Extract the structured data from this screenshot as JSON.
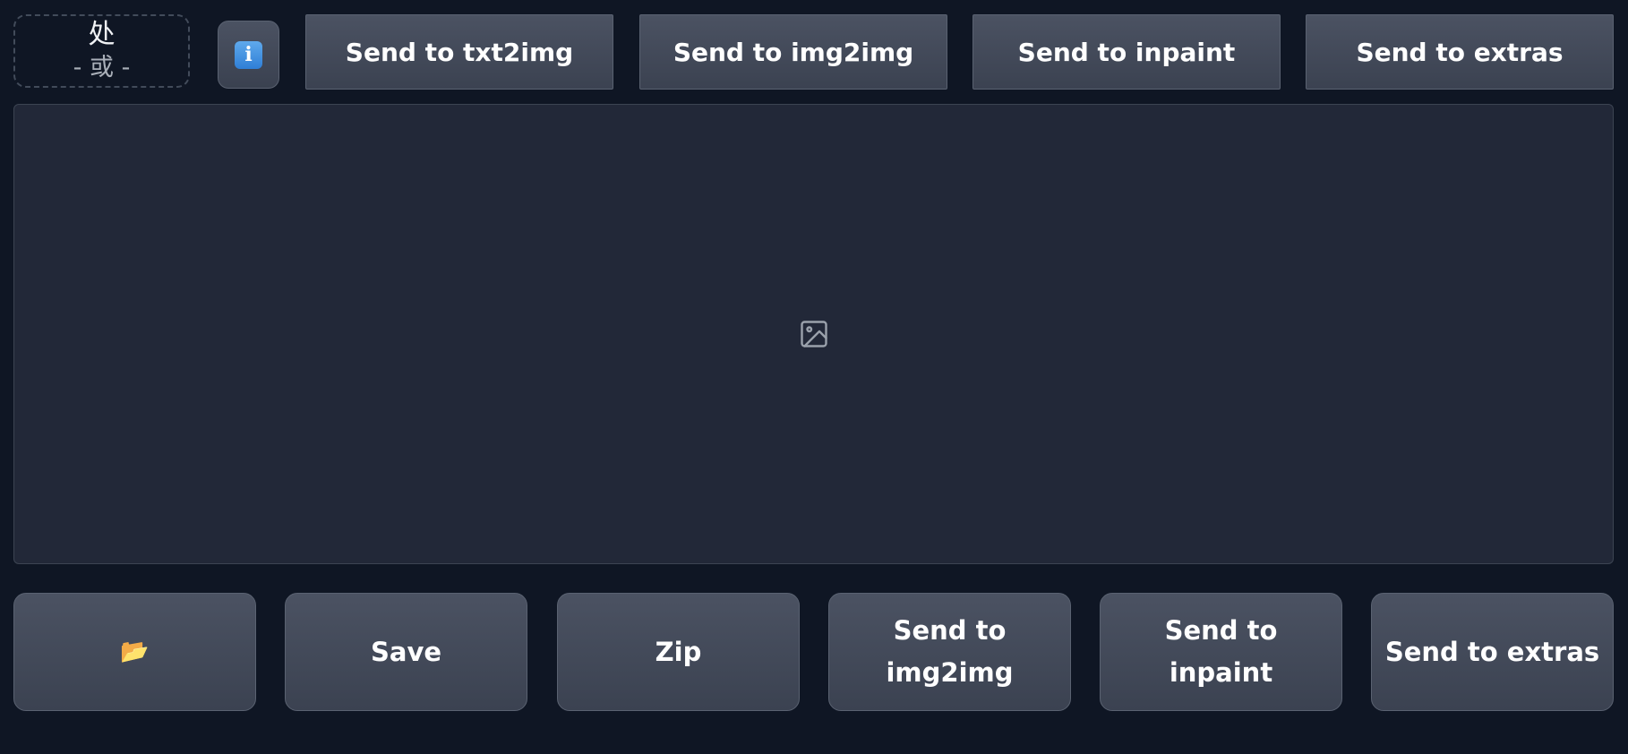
{
  "drop_zone": {
    "line1": "处",
    "line2": "- 或 -"
  },
  "info_button": {
    "icon": "info-icon",
    "glyph": "i"
  },
  "top_buttons": [
    {
      "label": "Send to txt2img"
    },
    {
      "label": "Send to img2img"
    },
    {
      "label": "Send to inpaint"
    },
    {
      "label": "Send to extras"
    }
  ],
  "gallery": {
    "icon": "image-placeholder-icon"
  },
  "bottom_buttons": [
    {
      "label": "📂",
      "icon": "folder-icon"
    },
    {
      "label": "Save"
    },
    {
      "label": "Zip"
    },
    {
      "label": "Send to img2img"
    },
    {
      "label": "Send to inpaint"
    },
    {
      "label": "Send to extras"
    }
  ],
  "colors": {
    "background": "#0f1624",
    "panel": "#222838",
    "button": "#444b5a",
    "info_icon": "#3b8fe0"
  }
}
